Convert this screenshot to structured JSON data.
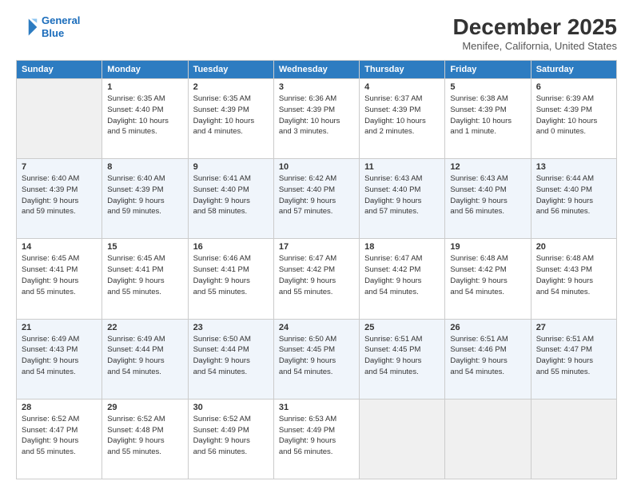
{
  "header": {
    "logo_line1": "General",
    "logo_line2": "Blue",
    "title": "December 2025",
    "subtitle": "Menifee, California, United States"
  },
  "days_of_week": [
    "Sunday",
    "Monday",
    "Tuesday",
    "Wednesday",
    "Thursday",
    "Friday",
    "Saturday"
  ],
  "weeks": [
    [
      {
        "num": "",
        "info": ""
      },
      {
        "num": "1",
        "info": "Sunrise: 6:35 AM\nSunset: 4:40 PM\nDaylight: 10 hours\nand 5 minutes."
      },
      {
        "num": "2",
        "info": "Sunrise: 6:35 AM\nSunset: 4:39 PM\nDaylight: 10 hours\nand 4 minutes."
      },
      {
        "num": "3",
        "info": "Sunrise: 6:36 AM\nSunset: 4:39 PM\nDaylight: 10 hours\nand 3 minutes."
      },
      {
        "num": "4",
        "info": "Sunrise: 6:37 AM\nSunset: 4:39 PM\nDaylight: 10 hours\nand 2 minutes."
      },
      {
        "num": "5",
        "info": "Sunrise: 6:38 AM\nSunset: 4:39 PM\nDaylight: 10 hours\nand 1 minute."
      },
      {
        "num": "6",
        "info": "Sunrise: 6:39 AM\nSunset: 4:39 PM\nDaylight: 10 hours\nand 0 minutes."
      }
    ],
    [
      {
        "num": "7",
        "info": "Sunrise: 6:40 AM\nSunset: 4:39 PM\nDaylight: 9 hours\nand 59 minutes."
      },
      {
        "num": "8",
        "info": "Sunrise: 6:40 AM\nSunset: 4:39 PM\nDaylight: 9 hours\nand 59 minutes."
      },
      {
        "num": "9",
        "info": "Sunrise: 6:41 AM\nSunset: 4:40 PM\nDaylight: 9 hours\nand 58 minutes."
      },
      {
        "num": "10",
        "info": "Sunrise: 6:42 AM\nSunset: 4:40 PM\nDaylight: 9 hours\nand 57 minutes."
      },
      {
        "num": "11",
        "info": "Sunrise: 6:43 AM\nSunset: 4:40 PM\nDaylight: 9 hours\nand 57 minutes."
      },
      {
        "num": "12",
        "info": "Sunrise: 6:43 AM\nSunset: 4:40 PM\nDaylight: 9 hours\nand 56 minutes."
      },
      {
        "num": "13",
        "info": "Sunrise: 6:44 AM\nSunset: 4:40 PM\nDaylight: 9 hours\nand 56 minutes."
      }
    ],
    [
      {
        "num": "14",
        "info": "Sunrise: 6:45 AM\nSunset: 4:41 PM\nDaylight: 9 hours\nand 55 minutes."
      },
      {
        "num": "15",
        "info": "Sunrise: 6:45 AM\nSunset: 4:41 PM\nDaylight: 9 hours\nand 55 minutes."
      },
      {
        "num": "16",
        "info": "Sunrise: 6:46 AM\nSunset: 4:41 PM\nDaylight: 9 hours\nand 55 minutes."
      },
      {
        "num": "17",
        "info": "Sunrise: 6:47 AM\nSunset: 4:42 PM\nDaylight: 9 hours\nand 55 minutes."
      },
      {
        "num": "18",
        "info": "Sunrise: 6:47 AM\nSunset: 4:42 PM\nDaylight: 9 hours\nand 54 minutes."
      },
      {
        "num": "19",
        "info": "Sunrise: 6:48 AM\nSunset: 4:42 PM\nDaylight: 9 hours\nand 54 minutes."
      },
      {
        "num": "20",
        "info": "Sunrise: 6:48 AM\nSunset: 4:43 PM\nDaylight: 9 hours\nand 54 minutes."
      }
    ],
    [
      {
        "num": "21",
        "info": "Sunrise: 6:49 AM\nSunset: 4:43 PM\nDaylight: 9 hours\nand 54 minutes."
      },
      {
        "num": "22",
        "info": "Sunrise: 6:49 AM\nSunset: 4:44 PM\nDaylight: 9 hours\nand 54 minutes."
      },
      {
        "num": "23",
        "info": "Sunrise: 6:50 AM\nSunset: 4:44 PM\nDaylight: 9 hours\nand 54 minutes."
      },
      {
        "num": "24",
        "info": "Sunrise: 6:50 AM\nSunset: 4:45 PM\nDaylight: 9 hours\nand 54 minutes."
      },
      {
        "num": "25",
        "info": "Sunrise: 6:51 AM\nSunset: 4:45 PM\nDaylight: 9 hours\nand 54 minutes."
      },
      {
        "num": "26",
        "info": "Sunrise: 6:51 AM\nSunset: 4:46 PM\nDaylight: 9 hours\nand 54 minutes."
      },
      {
        "num": "27",
        "info": "Sunrise: 6:51 AM\nSunset: 4:47 PM\nDaylight: 9 hours\nand 55 minutes."
      }
    ],
    [
      {
        "num": "28",
        "info": "Sunrise: 6:52 AM\nSunset: 4:47 PM\nDaylight: 9 hours\nand 55 minutes."
      },
      {
        "num": "29",
        "info": "Sunrise: 6:52 AM\nSunset: 4:48 PM\nDaylight: 9 hours\nand 55 minutes."
      },
      {
        "num": "30",
        "info": "Sunrise: 6:52 AM\nSunset: 4:49 PM\nDaylight: 9 hours\nand 56 minutes."
      },
      {
        "num": "31",
        "info": "Sunrise: 6:53 AM\nSunset: 4:49 PM\nDaylight: 9 hours\nand 56 minutes."
      },
      {
        "num": "",
        "info": ""
      },
      {
        "num": "",
        "info": ""
      },
      {
        "num": "",
        "info": ""
      }
    ]
  ]
}
